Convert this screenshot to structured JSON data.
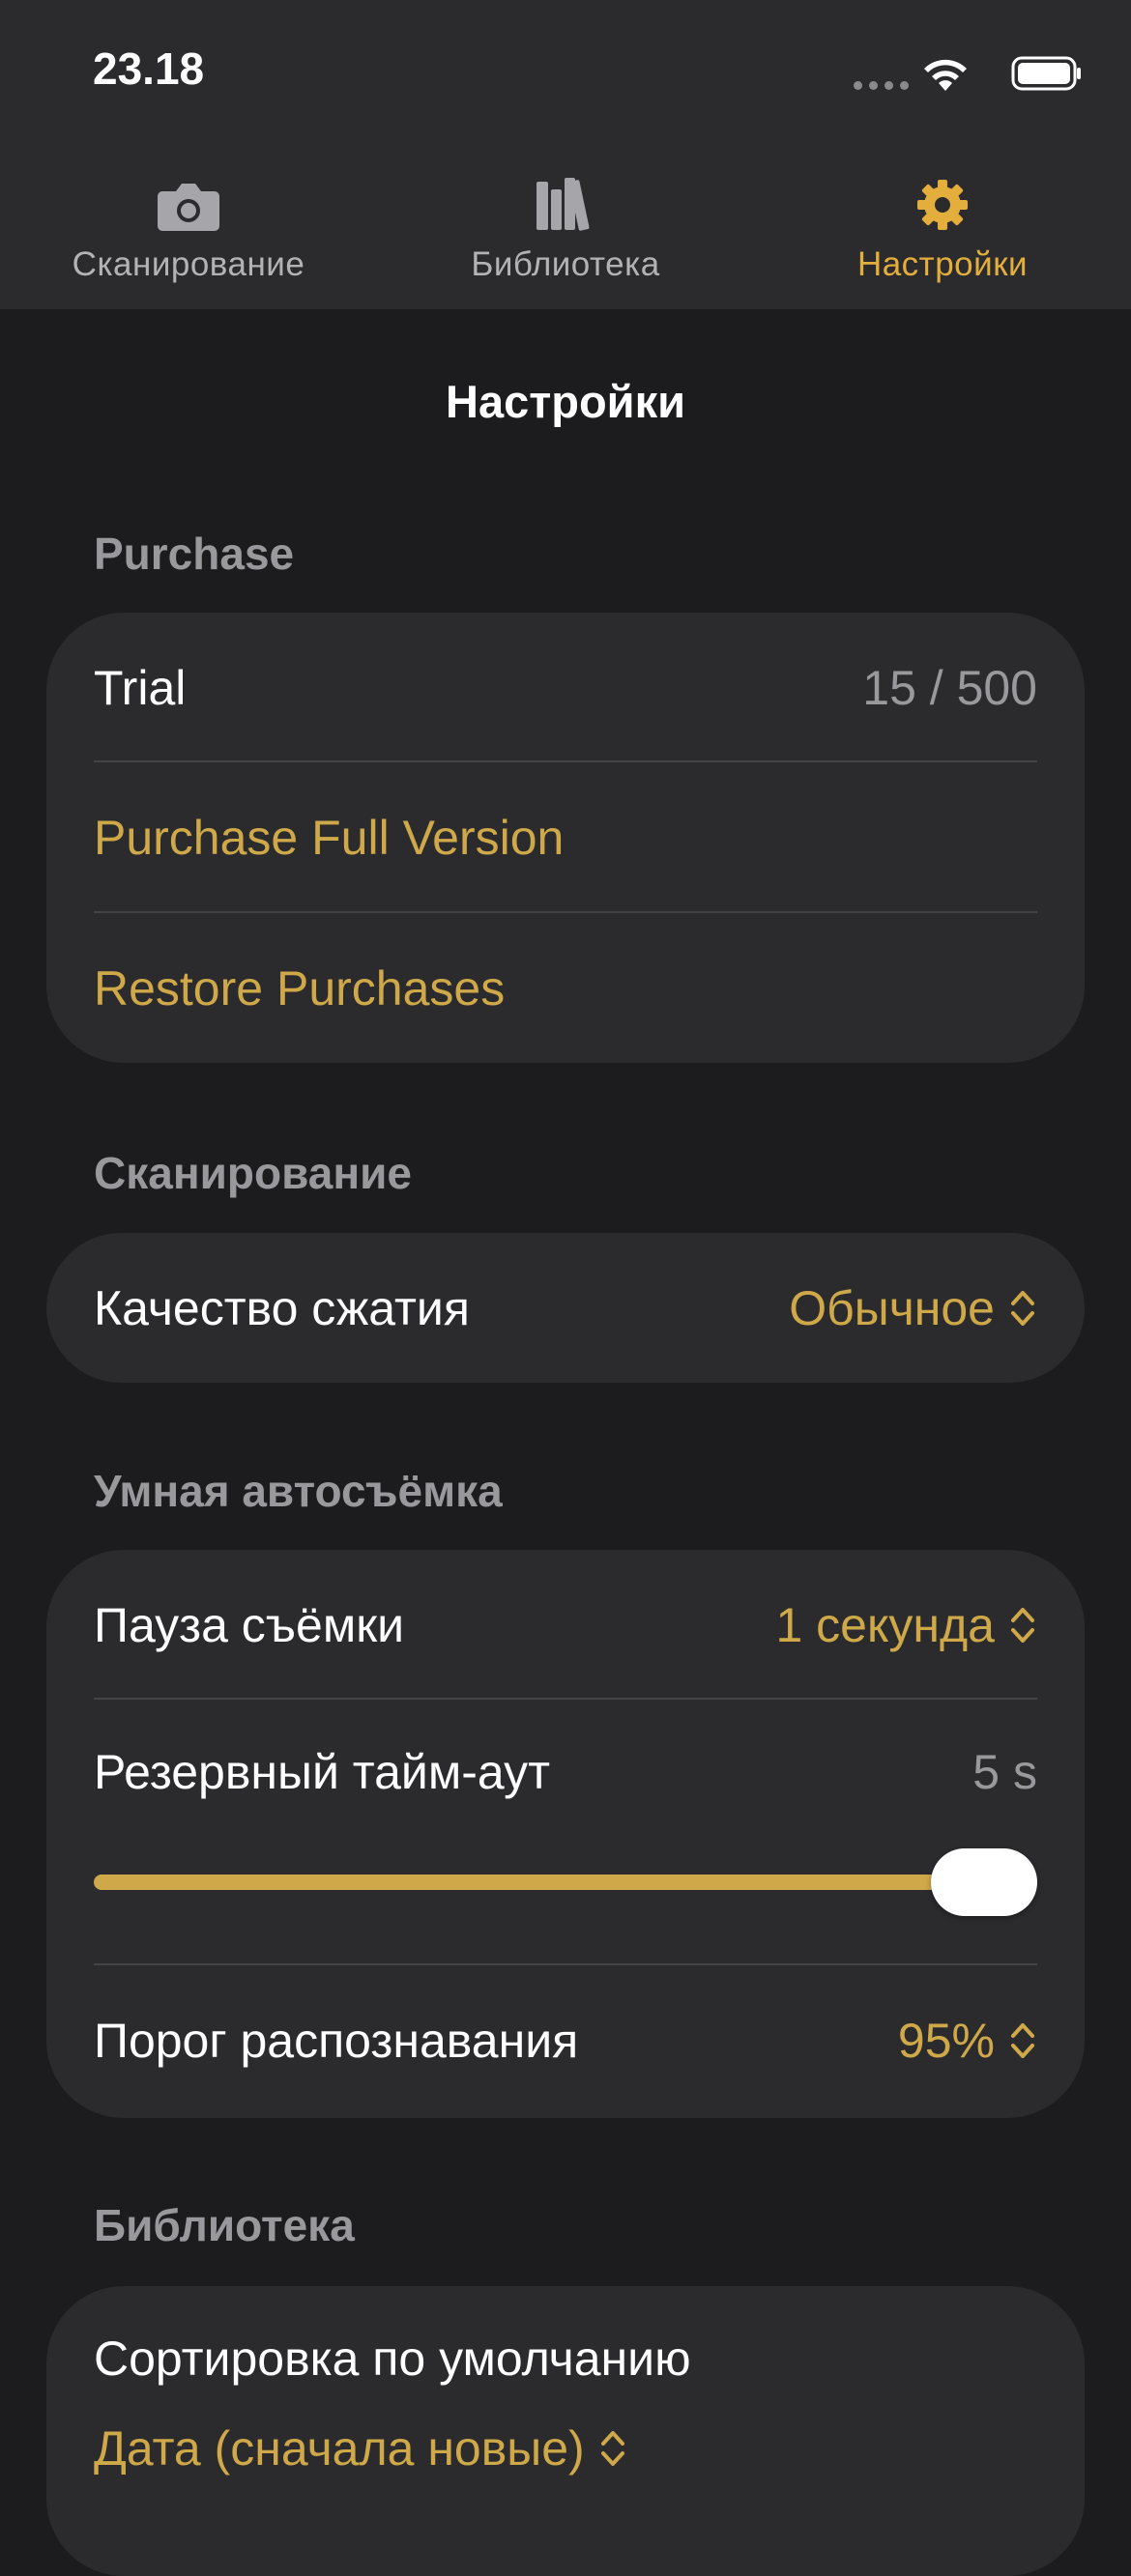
{
  "status_bar": {
    "time": "23.18"
  },
  "tabs": [
    {
      "label": "Сканирование",
      "icon": "camera-icon"
    },
    {
      "label": "Библиотека",
      "icon": "library-icon"
    },
    {
      "label": "Настройки",
      "icon": "gear-icon"
    }
  ],
  "nav": {
    "title": "Настройки"
  },
  "purchase": {
    "header": "Purchase",
    "trial_label": "Trial",
    "trial_value": "15 / 500",
    "purchase_full": "Purchase Full Version",
    "restore": "Restore Purchases"
  },
  "scanning": {
    "header": "Сканирование",
    "quality_label": "Качество сжатия",
    "quality_value": "Обычное"
  },
  "smart_capture": {
    "header": "Умная автосъёмка",
    "pause_label": "Пауза съёмки",
    "pause_value": "1 секунда",
    "timeout_label": "Резервный тайм-аут",
    "timeout_value": "5 s",
    "timeout_slider_fraction": 1.0,
    "threshold_label": "Порог распознавания",
    "threshold_value": "95%"
  },
  "library": {
    "header": "Библиотека",
    "sort_label": "Сортировка по умолчанию",
    "sort_value": "Дата (сначала новые)"
  },
  "colors": {
    "accent": "#e4ae3c",
    "accent_text": "#cfa949",
    "background": "#1c1c1e",
    "card": "#2b2b2d",
    "secondary_text": "#98989d"
  }
}
